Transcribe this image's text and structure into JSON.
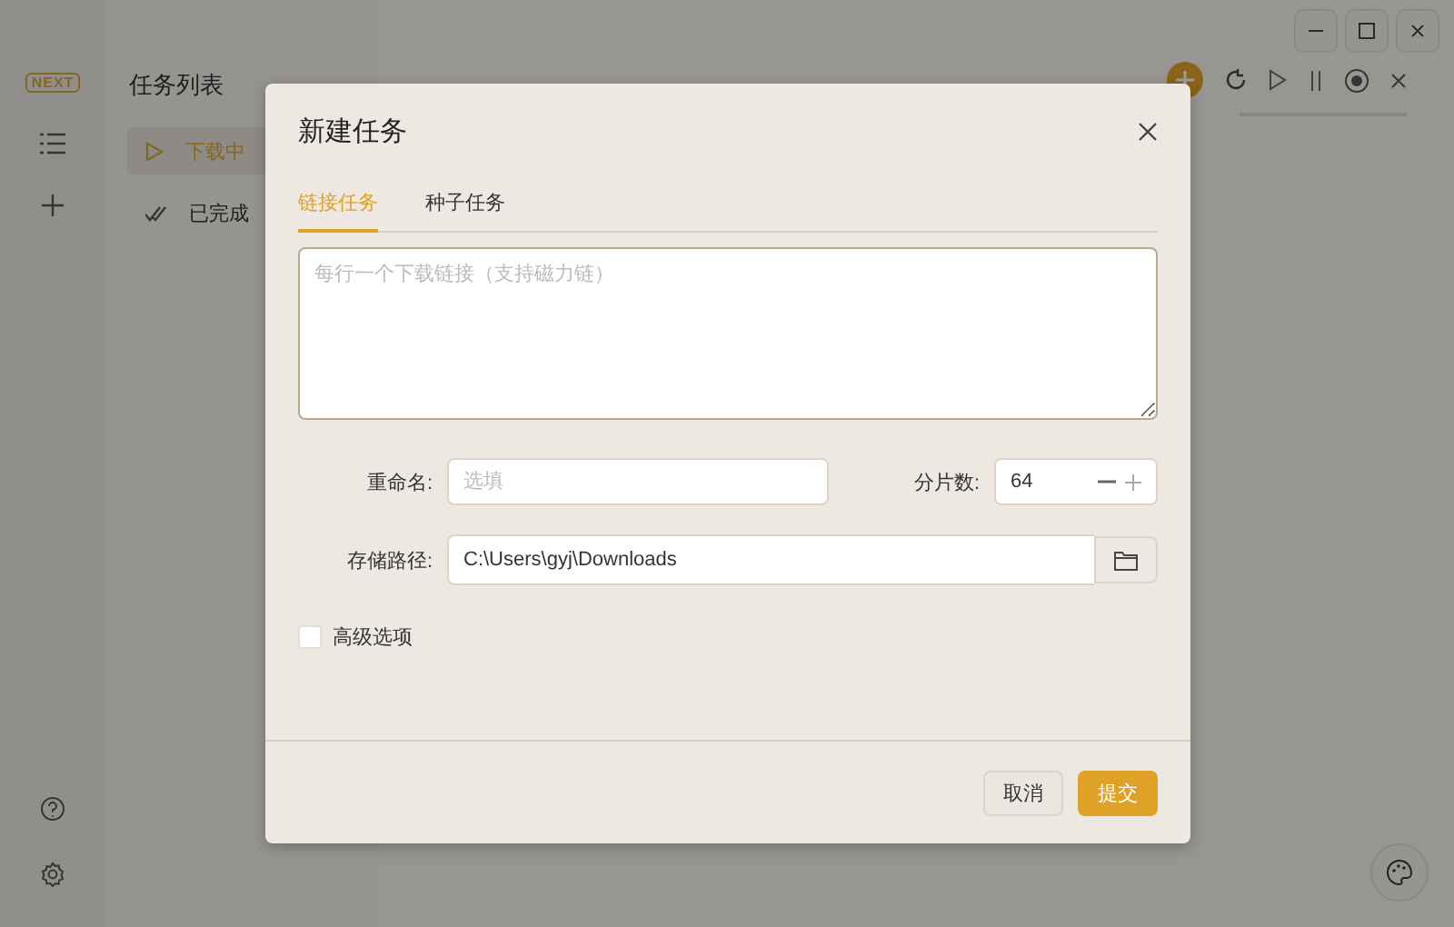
{
  "sidebar": {
    "logo": "NEXT"
  },
  "task_list": {
    "title": "任务列表",
    "items": [
      {
        "label": "下载中",
        "kind": "downloading",
        "selected": true
      },
      {
        "label": "已完成",
        "kind": "done",
        "selected": false
      }
    ]
  },
  "dialog": {
    "title": "新建任务",
    "tabs": [
      {
        "label": "链接任务",
        "selected": true
      },
      {
        "label": "种子任务",
        "selected": false
      }
    ],
    "links": {
      "placeholder": "每行一个下载链接（支持磁力链）"
    },
    "rename": {
      "label": "重命名:",
      "placeholder": "选填"
    },
    "segments": {
      "label": "分片数:",
      "value": "64"
    },
    "save_path": {
      "label": "存储路径:",
      "value": "C:\\Users\\gyj\\Downloads"
    },
    "advanced": {
      "label": "高级选项",
      "checked": false
    },
    "buttons": [
      {
        "label": "取消",
        "kind": "secondary"
      },
      {
        "label": "提交",
        "kind": "primary"
      }
    ]
  }
}
